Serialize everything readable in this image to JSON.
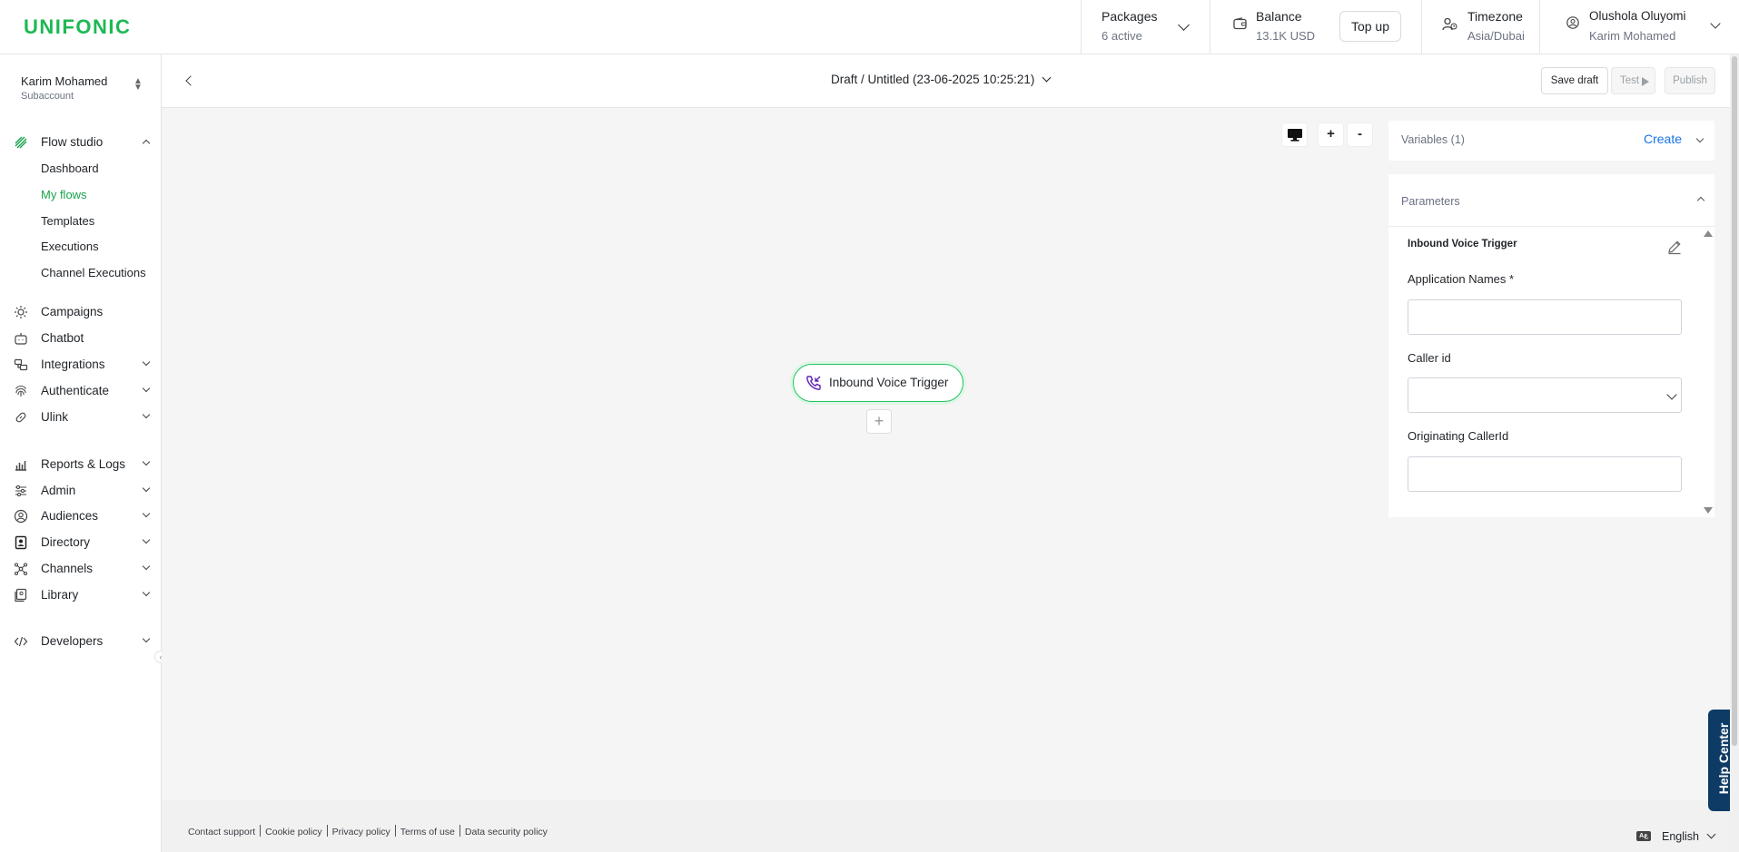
{
  "brand": {
    "logo": "UNIFONIC",
    "color": "#1db954"
  },
  "header": {
    "packages": {
      "title": "Packages",
      "value": "6 active"
    },
    "balance": {
      "title": "Balance",
      "value": "13.1K USD",
      "topup_label": "Top up"
    },
    "timezone": {
      "title": "Timezone",
      "value": "Asia/Dubai"
    },
    "user": {
      "name": "Olushola Oluyomi",
      "account": "Karim Mohamed"
    }
  },
  "sidebar": {
    "account": {
      "name": "Karim Mohamed",
      "type": "Subaccount"
    },
    "flow_studio": {
      "label": "Flow studio",
      "items": [
        {
          "label": "Dashboard"
        },
        {
          "label": "My flows",
          "active": true
        },
        {
          "label": "Templates"
        },
        {
          "label": "Executions"
        },
        {
          "label": "Channel Executions"
        }
      ]
    },
    "items": [
      {
        "label": "Campaigns",
        "icon": "campaigns-icon"
      },
      {
        "label": "Chatbot",
        "icon": "chatbot-icon"
      },
      {
        "label": "Integrations",
        "icon": "integrations-icon"
      },
      {
        "label": "Authenticate",
        "icon": "fingerprint-icon"
      },
      {
        "label": "Ulink",
        "icon": "link-icon"
      },
      {
        "label": "Reports & Logs",
        "icon": "reports-icon"
      },
      {
        "label": "Admin",
        "icon": "admin-icon"
      },
      {
        "label": "Audiences",
        "icon": "audiences-icon"
      },
      {
        "label": "Directory",
        "icon": "directory-icon"
      },
      {
        "label": "Channels",
        "icon": "channels-icon"
      },
      {
        "label": "Library",
        "icon": "library-icon"
      },
      {
        "label": "Developers",
        "icon": "code-icon"
      }
    ]
  },
  "editor": {
    "title": "Draft / Untitled (23-06-2025 10:25:21)",
    "save_label": "Save draft",
    "test_label": "Test",
    "publish_label": "Publish",
    "zoom_in": "+",
    "zoom_out": "-",
    "node_label": "Inbound Voice Trigger",
    "add_node": "+"
  },
  "panel": {
    "variables_title": "Variables (1)",
    "variables_create": "Create",
    "parameters_title": "Parameters",
    "trigger_title": "Inbound Voice Trigger",
    "fields": {
      "application_names": {
        "label": "Application Names *",
        "value": ""
      },
      "caller_id": {
        "label": "Caller id",
        "value": ""
      },
      "originating_caller_id": {
        "label": "Originating CallerId",
        "value": ""
      }
    }
  },
  "footer": {
    "links": [
      "Contact support",
      "Cookie policy",
      "Privacy policy",
      "Terms of use",
      "Data security policy"
    ],
    "language": "English"
  },
  "help_center": "Help Center",
  "colors": {
    "accent_green": "#17a34a",
    "link_blue": "#1a73e8",
    "help_navy": "#0d3b66"
  }
}
